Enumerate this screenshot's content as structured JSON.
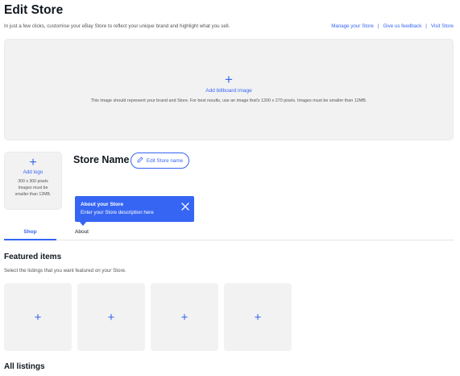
{
  "header": {
    "title": "Edit Store",
    "subtitle": "In just a few clicks, customise your eBay Store to reflect your unique brand and highlight what you sell.",
    "links": [
      "Manage your Store",
      "Give us feedback",
      "Visit Store"
    ],
    "separator": "|"
  },
  "billboard": {
    "plus": "+",
    "add_label": "Add billboard image",
    "hint": "This image should represent your brand and Store. For best results, use an image that's 1200 x 270 pixels. Images must be smaller than 12MB."
  },
  "logo": {
    "plus": "+",
    "add_label": "Add logo",
    "hint": "300 x 300 pixels Images must be smaller than 12MB."
  },
  "store": {
    "name": "Store Name",
    "edit_label": "Edit Store name"
  },
  "tooltip": {
    "title": "About your Store",
    "body": "Enter your Store description here"
  },
  "tabs": [
    {
      "label": "Shop",
      "selected": true
    },
    {
      "label": "About",
      "selected": false
    }
  ],
  "featured": {
    "title": "Featured items",
    "subtitle": "Select the listings that you want featured on your Store.",
    "slot_symbol": "+"
  },
  "all_listings": {
    "title": "All listings"
  },
  "colors": {
    "accent": "#3665f3",
    "placeholder_bg": "#f2f2f2",
    "text": "#111820"
  },
  "icons": {
    "edit": "pencil-icon",
    "close": "close-icon",
    "add": "plus-icon"
  }
}
